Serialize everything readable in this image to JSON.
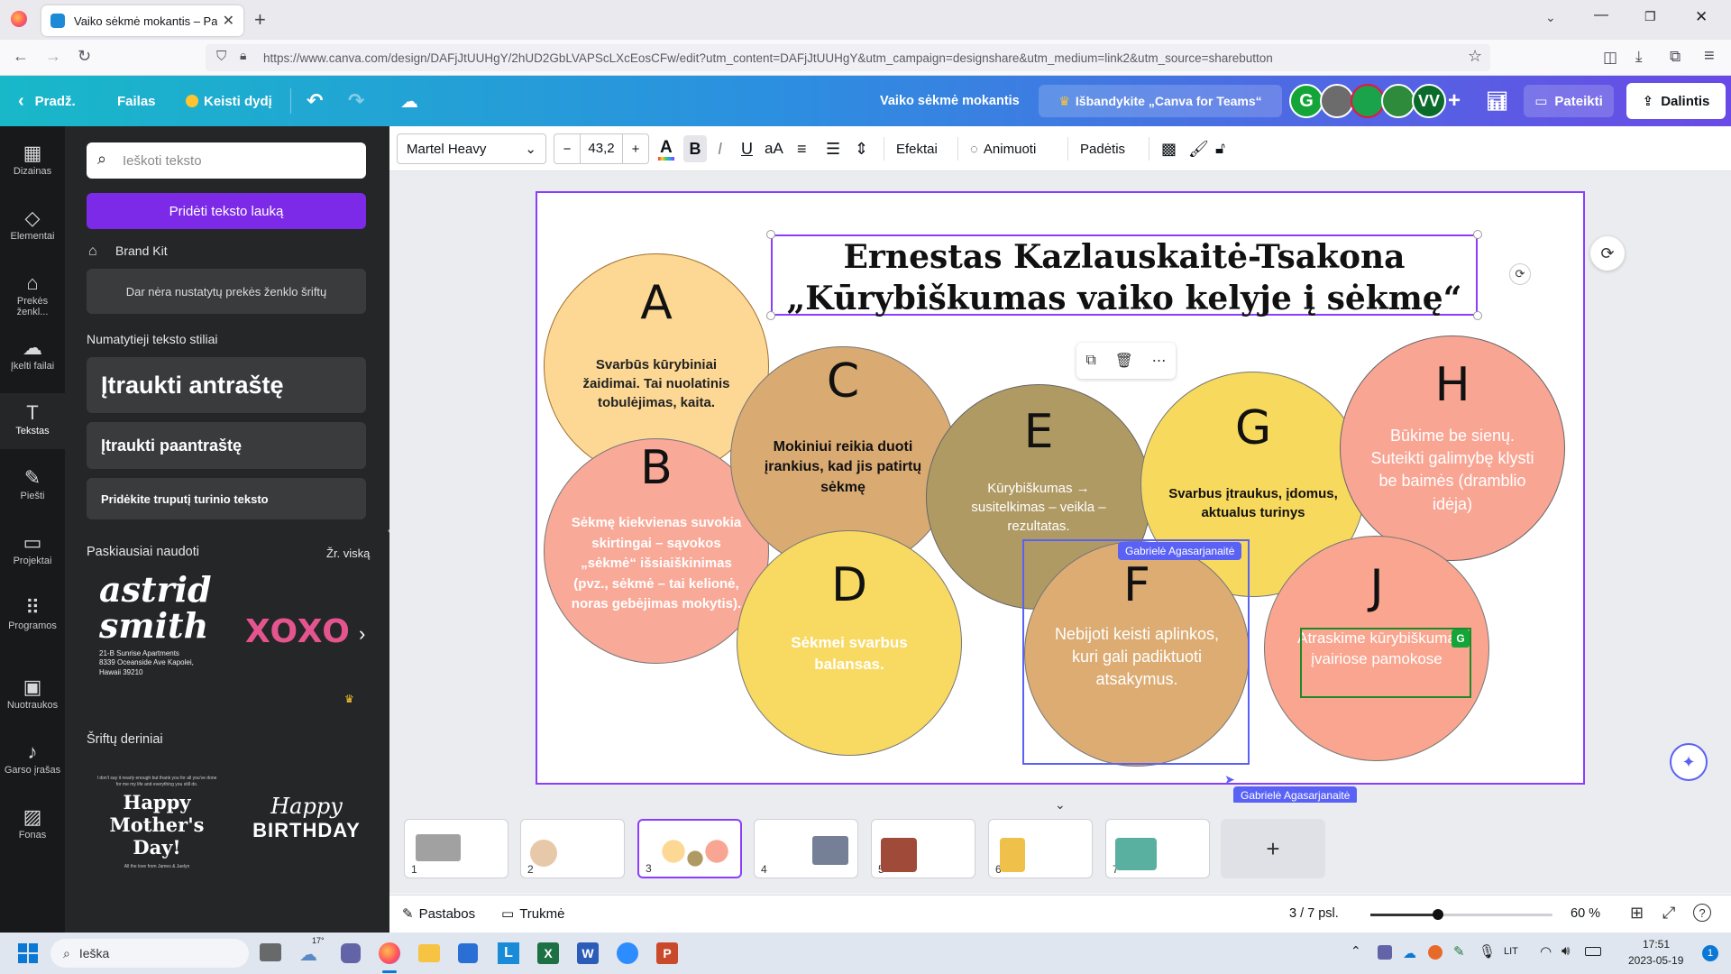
{
  "browser": {
    "tab_title": "Vaiko sėkmė mokantis – Pateiktis",
    "url": "https://www.canva.com/design/DAFjJtUUHgY/2hUD2GbLVAPScLXcEosCFw/edit?utm_content=DAFjJtUUHgY&utm_campaign=designshare&utm_medium=link2&utm_source=sharebutton"
  },
  "topbar": {
    "home": "Pradž.",
    "file": "Failas",
    "resize": "Keisti dydį",
    "doc_title": "Vaiko sėkmė mokantis",
    "teams": "Išbandykite „Canva for Teams“",
    "present": "Pateikti",
    "share": "Dalintis",
    "avatars": [
      "G",
      "VV"
    ]
  },
  "rail": [
    "Dizainas",
    "Elementai",
    "Prekės ženkl...",
    "Įkelti failai",
    "Tekstas",
    "Piešti",
    "Projektai",
    "Programos",
    "Nuotraukos",
    "Garso įrašas",
    "Fonas"
  ],
  "panel": {
    "search_placeholder": "Ieškoti teksto",
    "add_text": "Pridėti teksto lauką",
    "brand_kit": "Brand Kit",
    "no_brand_fonts": "Dar nėra nustatytų prekės ženklo šriftų",
    "default_styles": "Numatytieji teksto stiliai",
    "heading": "Įtraukti antraštę",
    "subheading": "Įtraukti paantraštę",
    "body": "Pridėkite truputį turinio teksto",
    "recent": "Paskiausiai naudoti",
    "see_all": "Žr. viską",
    "recent_1_name": "astrid smith",
    "recent_1_address": "21-B Sunrise Apartments 8339 Oceanside Ave Kapolei, Hawaii 39210",
    "recent_2": "XOXO",
    "combos": "Šriftų deriniai",
    "combo_1_small": "I don't say it nearly enough but thank you for all you've done for me my life and everything you still do.",
    "combo_1": "Happy Mother's Day!",
    "combo_1_sign": "All the love from James & Jaelyn",
    "combo_2_top": "Happy",
    "combo_2_bottom": "BIRTHDAY"
  },
  "toolbar": {
    "font": "Martel Heavy",
    "minus": "−",
    "size": "43,2",
    "plus": "+",
    "effects": "Efektai",
    "animate": "Animuoti",
    "position": "Padėtis"
  },
  "slide": {
    "title_line1": "Ernestas Kazlauskaitė-Tsakona",
    "title_line2": "„Kūrybiškumas vaiko kelyje į sėkmę“",
    "circles": {
      "A": {
        "letter": "A",
        "text": "Svarbūs kūrybiniai žaidimai. Tai nuolatinis tobulėjimas, kaita."
      },
      "B": {
        "letter": "B",
        "text": "Sėkmę kiekvienas suvokia skirtingai – sąvokos „sėkmė“ išsiaiškinimas (pvz., sėkmė – tai kelionė, noras gebėjimas mokytis)."
      },
      "C": {
        "letter": "C",
        "text": "Mokiniui reikia duoti įrankius, kad jis patirtų sėkmę"
      },
      "D": {
        "letter": "D",
        "text": "Sėkmei svarbus balansas."
      },
      "E": {
        "letter": "E",
        "text": "Kūrybiškumas → susitelkimas – veikla – rezultatas."
      },
      "F": {
        "letter": "F",
        "text": "Nebijoti keisti aplinkos, kuri gali padiktuoti atsakymus."
      },
      "G": {
        "letter": "G",
        "text": "Svarbus įtraukus, įdomus, aktualus turinys"
      },
      "H": {
        "letter": "H",
        "text": "Būkime be sienų. Suteikti galimybę klysti be baimės (dramblio idėja)"
      },
      "J": {
        "letter": "J",
        "text": "Atraskime kūrybiškumą įvairiose pamokose"
      }
    },
    "collab_name": "Gabrielė Agasarjanaitė",
    "collab_badge": "G"
  },
  "thumbs": [
    "1",
    "2",
    "3",
    "4",
    "5",
    "6",
    "7"
  ],
  "bottombar": {
    "notes": "Pastabos",
    "timing": "Trukmė",
    "pages": "3 / 7 psl.",
    "zoom": "60 %"
  },
  "taskbar": {
    "search": "Ieška",
    "temp": "17°",
    "lang": "LIT",
    "time": "17:51",
    "date": "2023-05-19"
  },
  "colors": {
    "accent": "#8b3dff",
    "collab": "#5a62f5",
    "circle_a": "#fdd895",
    "circle_b": "#f9a998",
    "circle_c": "#d9aa72",
    "circle_d": "#f8d962",
    "circle_e": "#b09a64",
    "circle_f": "#dcac73",
    "circle_g": "#f7d95d",
    "circle_h": "#f9a594",
    "circle_j": "#f9a58f"
  }
}
